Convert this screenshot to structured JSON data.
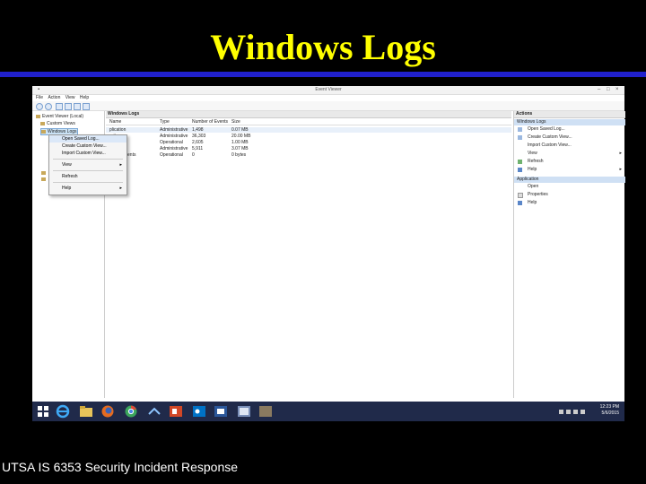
{
  "slide": {
    "title": "Windows Logs",
    "footer": "UTSA IS 6353 Security Incident Response"
  },
  "window": {
    "title": "Event Viewer",
    "menu": [
      "File",
      "Action",
      "View",
      "Help"
    ]
  },
  "tree": {
    "items": [
      "Event Viewer (Local)",
      "Custom Views",
      "Windows Logs"
    ]
  },
  "center": {
    "header": "Windows Logs",
    "columns": [
      "Name",
      "Type",
      "Number of Events",
      "Size"
    ],
    "rows": [
      [
        "plication",
        "Administrative",
        "1,498",
        "0.07 MB"
      ],
      [
        "urity",
        "Administrative",
        "36,303",
        "20.00 MB"
      ],
      [
        "up",
        "Operational",
        "2,605",
        "1.00 MB"
      ],
      [
        "em",
        "Administrative",
        "5,911",
        "3.07 MB"
      ],
      [
        "arded Events",
        "Operational",
        "0",
        "0 bytes"
      ]
    ]
  },
  "context_menu": {
    "items": [
      "Open Saved Log...",
      "Create Custom View...",
      "Import Custom View...",
      "View",
      "Refresh",
      "Help"
    ]
  },
  "actions": {
    "header": "Actions",
    "section1": "Windows Logs",
    "section1_items": [
      "Open Saved Log...",
      "Create Custom View...",
      "Import Custom View...",
      "View",
      "Refresh",
      "Help"
    ],
    "section2": "Application",
    "section2_items": [
      "Open",
      "Properties",
      "Help"
    ]
  },
  "taskbar": {
    "time": "12:23 PM",
    "date": "5/6/2015"
  },
  "colors": {
    "title": "#ffff00",
    "rule": "#2020cc",
    "taskbar": "#202a4a"
  }
}
